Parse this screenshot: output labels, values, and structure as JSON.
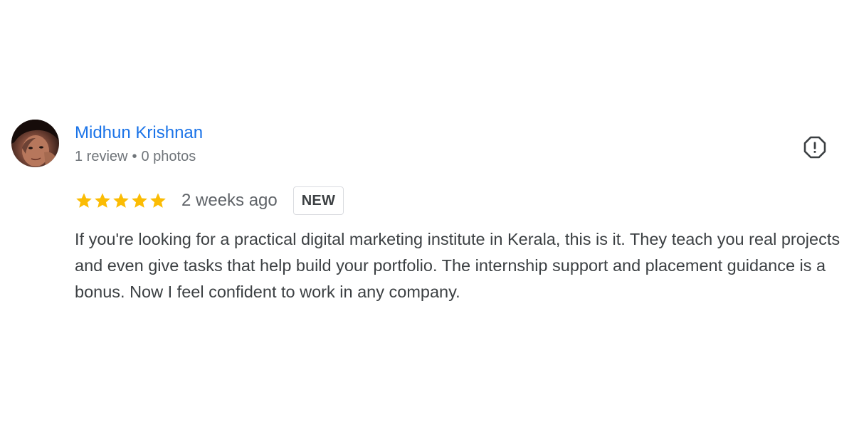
{
  "reviewer": {
    "name": "Midhun Krishnan",
    "reviews": "1 review",
    "separator": "•",
    "photos": "0 photos",
    "avatar_icon": "profile-photo"
  },
  "review": {
    "rating": 5,
    "rating_max": 5,
    "star_color": "#fbbc04",
    "time_ago": "2 weeks ago",
    "badge": "NEW",
    "text": "If you're looking for a practical digital marketing institute in Kerala, this is it. They teach you real projects and even give tasks that help build your portfolio. The internship support and placement guidance is a bonus. Now I feel confident to work in any company."
  },
  "actions": {
    "report_icon": "report-flag-icon"
  },
  "colors": {
    "name_link": "#1a73e8",
    "meta_text": "#70757a",
    "body_text": "#3c4043"
  }
}
